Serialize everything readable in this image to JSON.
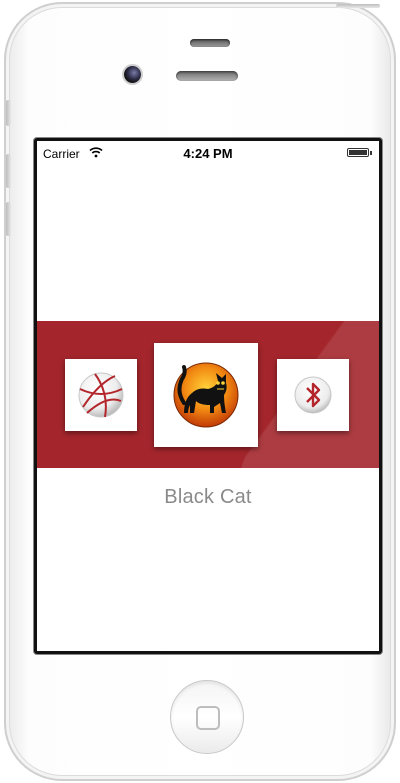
{
  "status_bar": {
    "carrier": "Carrier",
    "time": "4:24 PM",
    "wifi_icon": "wifi-icon",
    "battery_icon": "battery-icon",
    "battery_level": 1.0
  },
  "carousel": {
    "band_color": "#a4262c",
    "items": [
      {
        "icon": "basketball-icon",
        "selected": false
      },
      {
        "icon": "black-cat-icon",
        "selected": true
      },
      {
        "icon": "bluetooth-icon",
        "selected": false
      }
    ],
    "selected_label": "Black Cat"
  }
}
